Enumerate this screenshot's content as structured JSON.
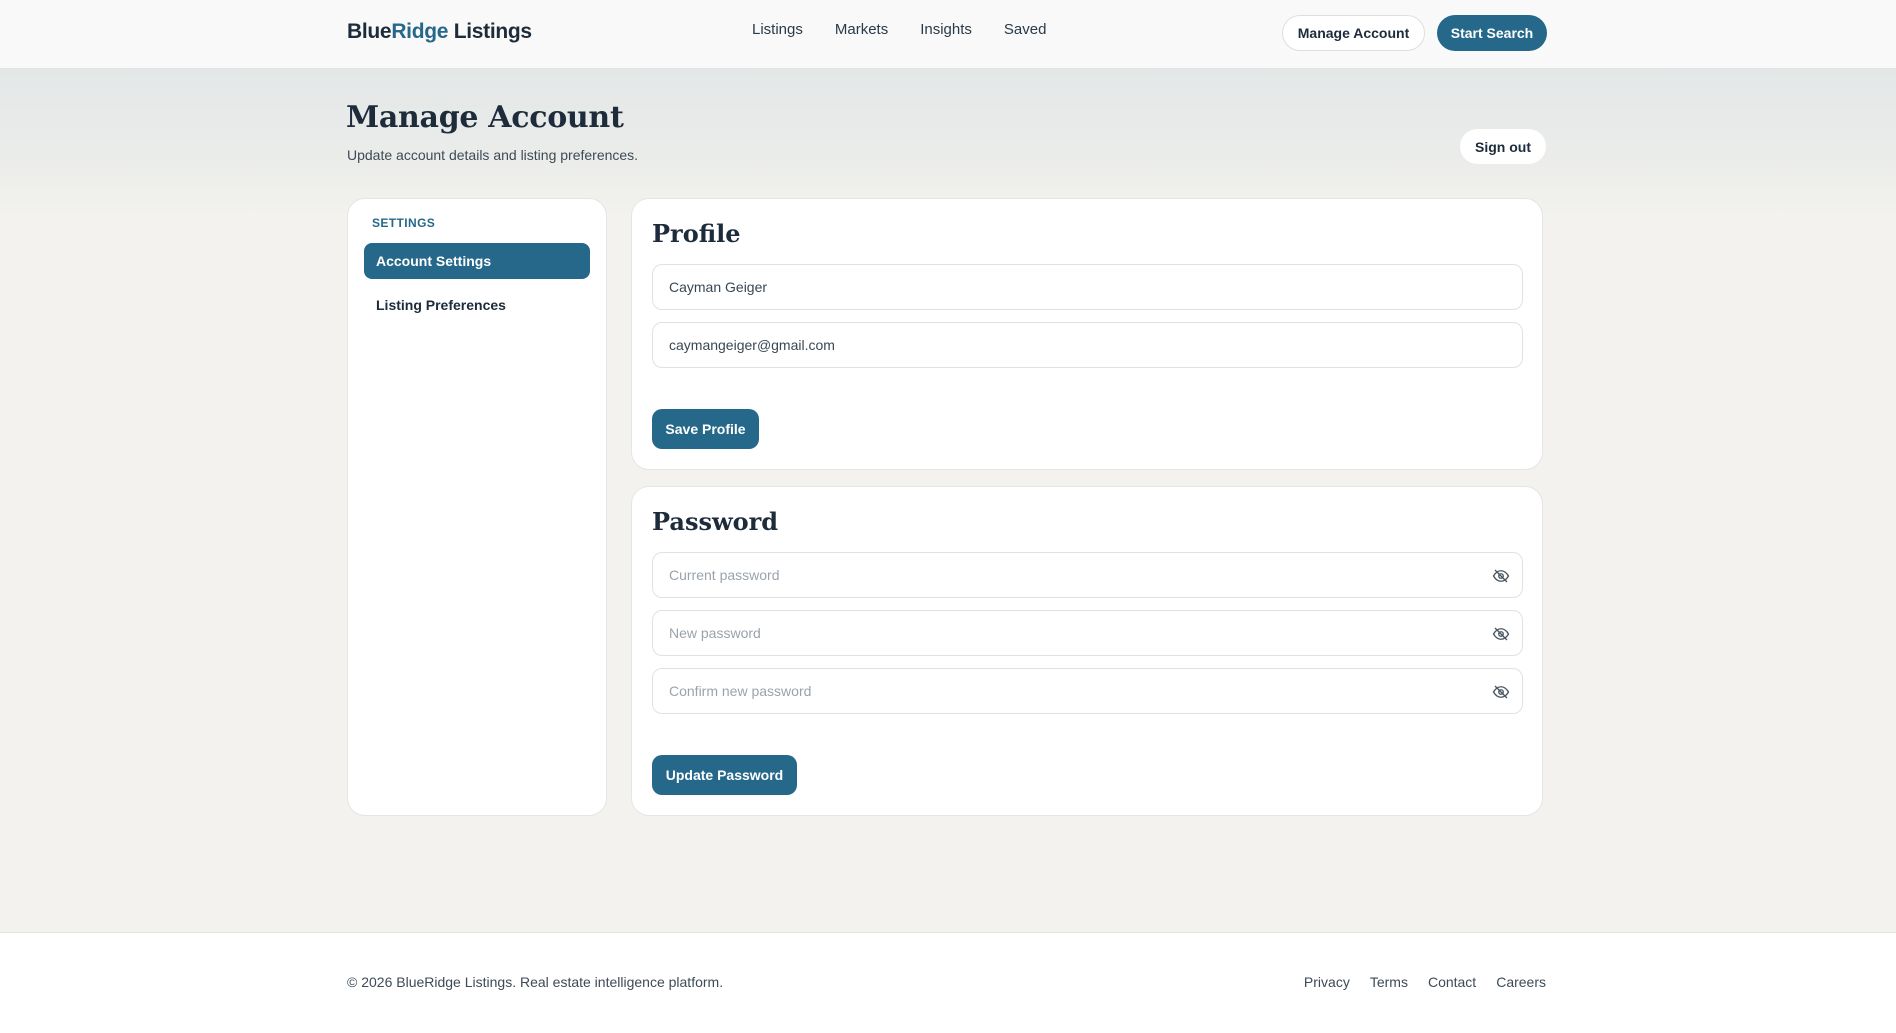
{
  "header": {
    "logo_part1": "Blue",
    "logo_part2": "Ridge",
    "logo_part3": " Listings",
    "nav": [
      "Listings",
      "Markets",
      "Insights",
      "Saved"
    ],
    "manage_account_label": "Manage Account",
    "start_search_label": "Start Search"
  },
  "page": {
    "title": "Manage Account",
    "subtitle": "Update account details and listing preferences.",
    "signout_label": "Sign out"
  },
  "sidebar": {
    "heading": "SETTINGS",
    "items": [
      {
        "label": "Account Settings",
        "active": true
      },
      {
        "label": "Listing Preferences",
        "active": false
      }
    ]
  },
  "profile": {
    "title": "Profile",
    "name_value": "Cayman Geiger",
    "email_value": "caymangeiger@gmail.com",
    "save_label": "Save Profile"
  },
  "password": {
    "title": "Password",
    "current_placeholder": "Current password",
    "new_placeholder": "New password",
    "confirm_placeholder": "Confirm new password",
    "update_label": "Update Password"
  },
  "footer": {
    "copyright": "© 2026 BlueRidge Listings. Real estate intelligence platform.",
    "links": [
      "Privacy",
      "Terms",
      "Contact",
      "Careers"
    ]
  },
  "colors": {
    "accent": "#26688a",
    "text": "#1d2b3a",
    "page_bg": "#f3f2ee"
  },
  "icons": {
    "password_toggle": "eye-slash-icon"
  }
}
